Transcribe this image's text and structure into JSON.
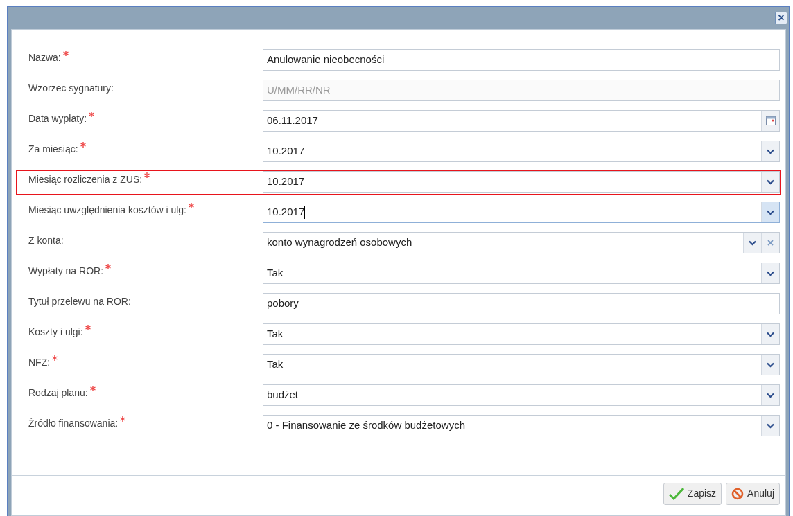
{
  "dialog": {
    "close_label": "×"
  },
  "fields": [
    {
      "label": "Nazwa:",
      "required": true,
      "kind": "text",
      "value": "Anulowanie nieobecności",
      "disabled": false,
      "focused": false,
      "highlighted": false
    },
    {
      "label": "Wzorzec sygnatury:",
      "required": false,
      "kind": "text",
      "value": "U/MM/RR/NR",
      "disabled": true,
      "focused": false,
      "highlighted": false
    },
    {
      "label": "Data wypłaty:",
      "required": true,
      "kind": "date",
      "value": "06.11.2017",
      "disabled": false,
      "focused": false,
      "highlighted": false
    },
    {
      "label": "Za miesiąc:",
      "required": true,
      "kind": "combo",
      "value": "10.2017",
      "disabled": false,
      "focused": false,
      "highlighted": false
    },
    {
      "label": "Miesiąc rozliczenia z ZUS:",
      "required": true,
      "kind": "combo",
      "value": "10.2017",
      "disabled": false,
      "focused": false,
      "highlighted": true
    },
    {
      "label": "Miesiąc uwzględnienia kosztów i ulg:",
      "required": true,
      "kind": "combo",
      "value": "10.2017",
      "disabled": false,
      "focused": true,
      "highlighted": false
    },
    {
      "label": "Z konta:",
      "required": false,
      "kind": "combo_clear",
      "value": "konto wynagrodzeń osobowych",
      "disabled": false,
      "focused": false,
      "highlighted": false
    },
    {
      "label": "Wypłaty na ROR:",
      "required": true,
      "kind": "combo",
      "value": "Tak",
      "disabled": false,
      "focused": false,
      "highlighted": false
    },
    {
      "label": "Tytuł przelewu na ROR:",
      "required": false,
      "kind": "text",
      "value": "pobory",
      "disabled": false,
      "focused": false,
      "highlighted": false
    },
    {
      "label": "Koszty i ulgi:",
      "required": true,
      "kind": "combo",
      "value": "Tak",
      "disabled": false,
      "focused": false,
      "highlighted": false
    },
    {
      "label": "NFZ:",
      "required": true,
      "kind": "combo",
      "value": "Tak",
      "disabled": false,
      "focused": false,
      "highlighted": false
    },
    {
      "label": "Rodzaj planu:",
      "required": true,
      "kind": "combo",
      "value": "budżet",
      "disabled": false,
      "focused": false,
      "highlighted": false
    },
    {
      "label": "Źródło finansowania:",
      "required": true,
      "kind": "combo",
      "value": "0 - Finansowanie ze środków budżetowych",
      "disabled": false,
      "focused": false,
      "highlighted": false
    }
  ],
  "buttons": [
    {
      "kind": "save",
      "label": "Zapisz"
    },
    {
      "kind": "cancel",
      "label": "Anuluj"
    }
  ]
}
